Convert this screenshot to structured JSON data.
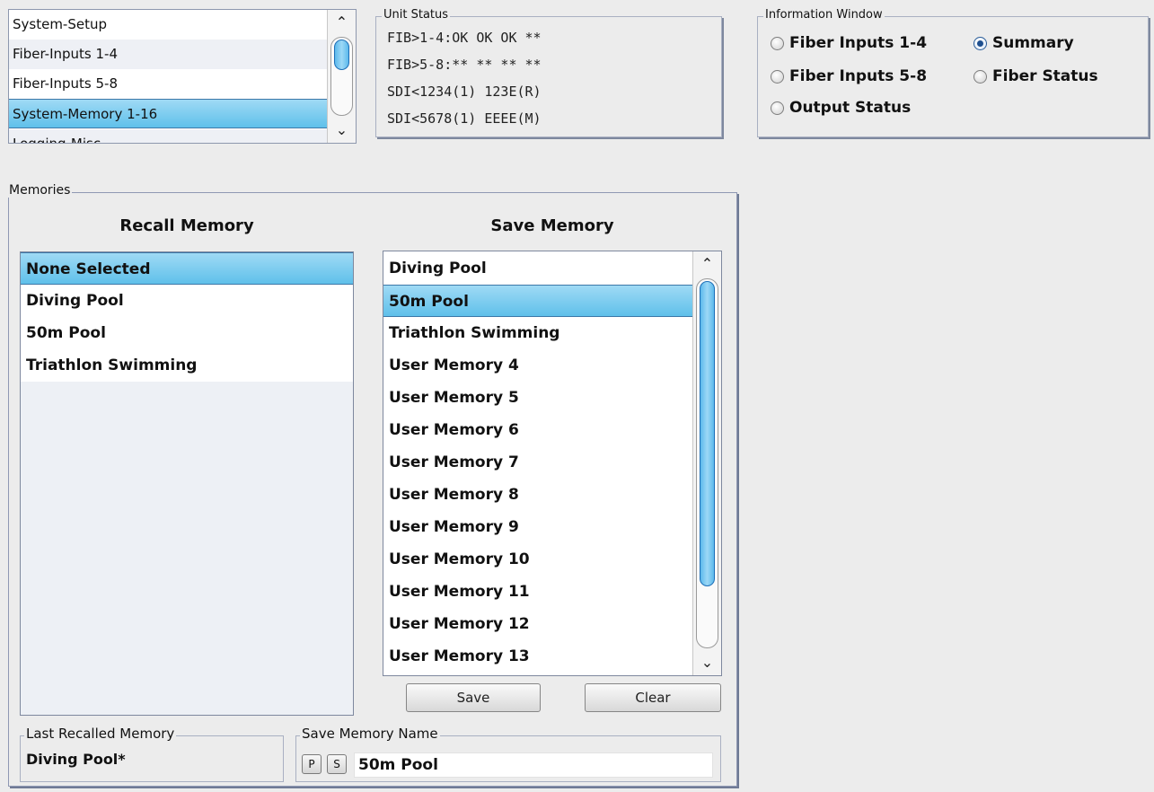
{
  "nav": {
    "items": [
      {
        "label": "System-Setup"
      },
      {
        "label": "Fiber-Inputs 1-4"
      },
      {
        "label": "Fiber-Inputs 5-8"
      },
      {
        "label": "System-Memory 1-16"
      },
      {
        "label": "Logging-Misc"
      }
    ],
    "selected_index": 3
  },
  "unit_status": {
    "title": "Unit Status",
    "lines": [
      "FIB>1-4:OK OK OK **",
      "FIB>5-8:** ** ** **",
      "SDI<1234(1) 123E(R)",
      "SDI<5678(1) EEEE(M)"
    ]
  },
  "info_window": {
    "title": "Information Window",
    "options": [
      {
        "label": "Fiber Inputs 1-4",
        "checked": false
      },
      {
        "label": "Summary",
        "checked": true
      },
      {
        "label": "Fiber Inputs 5-8",
        "checked": false
      },
      {
        "label": "Fiber Status",
        "checked": false
      },
      {
        "label": "Output Status",
        "checked": false
      }
    ]
  },
  "memories": {
    "title": "Memories",
    "recall_heading": "Recall Memory",
    "save_heading": "Save Memory",
    "recall_items": [
      "None Selected",
      "Diving Pool",
      "50m Pool",
      "Triathlon Swimming"
    ],
    "recall_selected_index": 0,
    "save_items": [
      "Diving Pool",
      "50m Pool",
      "Triathlon Swimming",
      "User Memory 4",
      "User Memory 5",
      "User Memory 6",
      "User Memory 7",
      "User Memory 8",
      "User Memory 9",
      "User Memory 10",
      "User Memory 11",
      "User Memory 12",
      "User Memory 13"
    ],
    "save_selected_index": 1,
    "save_button": "Save",
    "clear_button": "Clear",
    "last_recalled": {
      "title": "Last Recalled Memory",
      "value": "Diving Pool*"
    },
    "save_name": {
      "title": "Save Memory Name",
      "p_label": "P",
      "s_label": "S",
      "value": "50m Pool"
    }
  }
}
